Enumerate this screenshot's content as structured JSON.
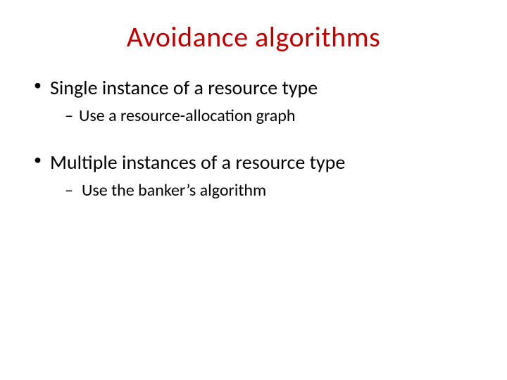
{
  "title": "Avoidance algorithms",
  "bullets": [
    {
      "text": "Single instance of a resource type",
      "sub": "Use a resource-allocation graph"
    },
    {
      "text": "Multiple instances of a resource type",
      "sub": " Use the banker’s algorithm"
    }
  ]
}
